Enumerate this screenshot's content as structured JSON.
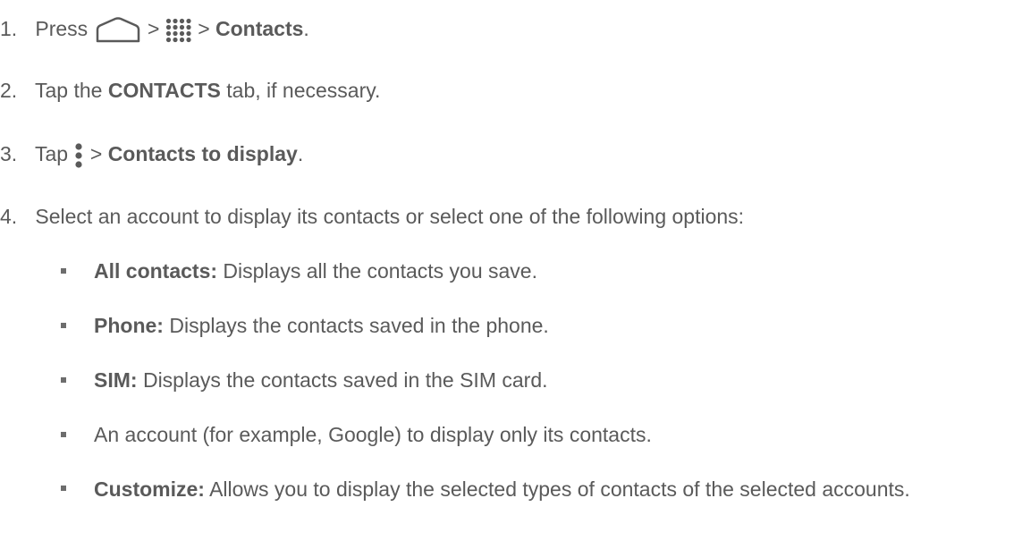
{
  "steps": [
    {
      "number": "1.",
      "text_before": "Press",
      "sep1": ">",
      "sep2": ">",
      "bold": "Contacts",
      "end": ".",
      "icons": [
        "home-icon",
        "apps-icon"
      ]
    },
    {
      "number": "2.",
      "text_before": "Tap the",
      "bold": "CONTACTS",
      "text_after": "tab, if necessary."
    },
    {
      "number": "3.",
      "text_before": "Tap",
      "sep": ">",
      "bold": "Contacts to display",
      "end": ".",
      "icons": [
        "menu-icon"
      ]
    },
    {
      "number": "4.",
      "text": "Select an account to display its contacts or select one of the following options:"
    }
  ],
  "options": [
    {
      "label": "All contacts:",
      "text": "Displays all the contacts you save."
    },
    {
      "label": "Phone:",
      "text": "Displays the contacts saved in the phone."
    },
    {
      "label": "SIM:",
      "text": "Displays the contacts saved in the SIM card."
    },
    {
      "label": "",
      "text": "An account (for example, Google) to display only its contacts."
    },
    {
      "label": "Customize:",
      "text": "Allows you to display the selected types of contacts of the selected accounts."
    }
  ],
  "colors": {
    "text": "#5a5a5a",
    "bullet": "#6d6d6d"
  }
}
